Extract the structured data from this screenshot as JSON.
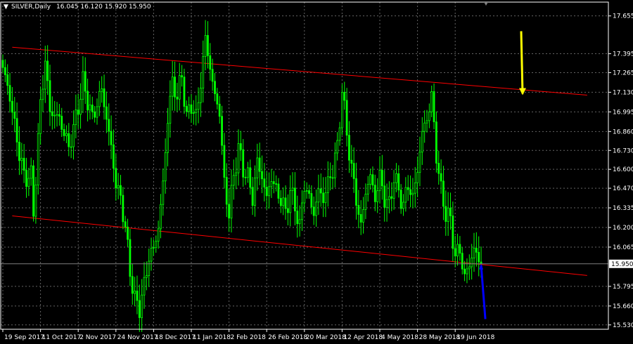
{
  "header": {
    "symbol": "SILVER,Daily",
    "ohlc": "16.045 16.120 15.920 15.950"
  },
  "colors": {
    "background": "#000000",
    "grid": "#646464",
    "bull": "#00FF00",
    "bear": "#00FF00",
    "trendline": "#FF0000",
    "price_line": "#7F7F7F",
    "axis_text": "#FFFFFF",
    "current_price_bg": "#FFFFFF",
    "current_price_fg": "#000000",
    "arrow_down": "#FFFF00",
    "arrow_blue": "#0000FF"
  },
  "chart_data": {
    "type": "candlestick",
    "title": "SILVER,Daily",
    "xlabel": "",
    "ylabel": "",
    "ylim": [
      15.5,
      17.75
    ],
    "grid": true,
    "y_ticks": [
      "17.655",
      "17.395",
      "17.265",
      "17.130",
      "16.995",
      "16.860",
      "16.730",
      "16.600",
      "16.470",
      "16.335",
      "16.200",
      "16.065",
      "15.795",
      "15.660",
      "15.530"
    ],
    "x_ticks": [
      {
        "label": "19 Sep 2017",
        "index": 0
      },
      {
        "label": "11 Oct 2017",
        "index": 16
      },
      {
        "label": "2 Nov 2017",
        "index": 32
      },
      {
        "label": "24 Nov 2017",
        "index": 48
      },
      {
        "label": "18 Dec 2017",
        "index": 64
      },
      {
        "label": "11 Jan 2018",
        "index": 80
      },
      {
        "label": "2 Feb 2018",
        "index": 96
      },
      {
        "label": "26 Feb 2018",
        "index": 112
      },
      {
        "label": "20 Mar 2018",
        "index": 128
      },
      {
        "label": "12 Apr 2018",
        "index": 144
      },
      {
        "label": "4 May 2018",
        "index": 160
      },
      {
        "label": "28 May 2018",
        "index": 176
      },
      {
        "label": "19 Jun 2018",
        "index": 192
      }
    ],
    "anchors": [
      [
        0,
        17.3
      ],
      [
        3,
        17.1
      ],
      [
        6,
        16.8
      ],
      [
        9,
        16.55
      ],
      [
        12,
        16.55
      ],
      [
        13,
        16.3
      ],
      [
        16,
        17.05
      ],
      [
        18,
        17.35
      ],
      [
        20,
        17.0
      ],
      [
        24,
        16.95
      ],
      [
        28,
        16.75
      ],
      [
        31,
        16.95
      ],
      [
        34,
        17.2
      ],
      [
        38,
        16.95
      ],
      [
        42,
        17.15
      ],
      [
        46,
        16.75
      ],
      [
        48,
        16.5
      ],
      [
        50,
        16.4
      ],
      [
        52,
        16.2
      ],
      [
        54,
        15.9
      ],
      [
        56,
        15.7
      ],
      [
        58,
        15.65
      ],
      [
        60,
        15.8
      ],
      [
        62,
        16.0
      ],
      [
        64,
        16.05
      ],
      [
        66,
        16.2
      ],
      [
        68,
        16.5
      ],
      [
        70,
        16.95
      ],
      [
        72,
        17.2
      ],
      [
        74,
        17.1
      ],
      [
        76,
        17.25
      ],
      [
        78,
        16.95
      ],
      [
        80,
        17.05
      ],
      [
        82,
        16.95
      ],
      [
        84,
        17.2
      ],
      [
        86,
        17.5
      ],
      [
        88,
        17.3
      ],
      [
        90,
        17.1
      ],
      [
        92,
        17.0
      ],
      [
        94,
        16.5
      ],
      [
        96,
        16.3
      ],
      [
        98,
        16.55
      ],
      [
        100,
        16.75
      ],
      [
        102,
        16.6
      ],
      [
        104,
        16.55
      ],
      [
        106,
        16.4
      ],
      [
        108,
        16.65
      ],
      [
        110,
        16.55
      ],
      [
        112,
        16.4
      ],
      [
        114,
        16.55
      ],
      [
        116,
        16.45
      ],
      [
        118,
        16.4
      ],
      [
        120,
        16.3
      ],
      [
        122,
        16.45
      ],
      [
        124,
        16.35
      ],
      [
        126,
        16.2
      ],
      [
        128,
        16.5
      ],
      [
        130,
        16.4
      ],
      [
        132,
        16.3
      ],
      [
        134,
        16.45
      ],
      [
        136,
        16.4
      ],
      [
        138,
        16.5
      ],
      [
        140,
        16.6
      ],
      [
        142,
        16.75
      ],
      [
        144,
        17.15
      ],
      [
        146,
        16.85
      ],
      [
        148,
        16.6
      ],
      [
        150,
        16.4
      ],
      [
        152,
        16.2
      ],
      [
        154,
        16.45
      ],
      [
        156,
        16.55
      ],
      [
        158,
        16.4
      ],
      [
        160,
        16.55
      ],
      [
        162,
        16.4
      ],
      [
        164,
        16.35
      ],
      [
        166,
        16.55
      ],
      [
        168,
        16.45
      ],
      [
        170,
        16.35
      ],
      [
        172,
        16.5
      ],
      [
        174,
        16.4
      ],
      [
        176,
        16.6
      ],
      [
        178,
        16.85
      ],
      [
        180,
        16.95
      ],
      [
        182,
        17.1
      ],
      [
        184,
        16.7
      ],
      [
        186,
        16.45
      ],
      [
        188,
        16.3
      ],
      [
        190,
        16.25
      ],
      [
        192,
        16.0
      ],
      [
        194,
        16.05
      ],
      [
        196,
        15.85
      ],
      [
        198,
        15.95
      ],
      [
        200,
        16.05
      ],
      [
        202,
        15.97
      ],
      [
        203,
        15.95
      ]
    ],
    "trendlines": [
      {
        "from": {
          "index": 4,
          "price": 17.44
        },
        "to": {
          "index": 248,
          "price": 17.11
        }
      },
      {
        "from": {
          "index": 4,
          "price": 16.28
        },
        "to": {
          "index": 248,
          "price": 15.87
        }
      }
    ],
    "current_price": {
      "value": 15.95,
      "label": "15.950"
    },
    "arrows": [
      {
        "color_key": "arrow_down",
        "index": 220,
        "from_price": 17.55,
        "to_price": 17.12
      },
      {
        "color_key": "arrow_blue",
        "index": 203,
        "from_price": 15.94,
        "to_price": 15.57
      }
    ]
  }
}
